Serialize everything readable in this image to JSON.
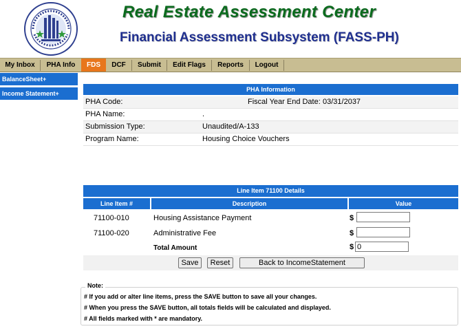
{
  "header": {
    "title": "Real Estate Assessment Center",
    "subtitle": "Financial Assessment Subsystem (FASS-PH)"
  },
  "nav": {
    "items": [
      {
        "label": "My Inbox"
      },
      {
        "label": "PHA Info"
      },
      {
        "label": "FDS",
        "active": true
      },
      {
        "label": "DCF"
      },
      {
        "label": "Submit"
      },
      {
        "label": "Edit Flags"
      },
      {
        "label": "Reports"
      },
      {
        "label": "Logout"
      }
    ]
  },
  "sidebar": {
    "items": [
      {
        "label": "BalanceSheet+"
      },
      {
        "label": "Income Statement+"
      }
    ]
  },
  "pha_info": {
    "title": "PHA Information",
    "code_label": "PHA Code:",
    "fiscal_year_label": "Fiscal Year End Date:",
    "fiscal_year_value": "03/31/2037",
    "name_label": "PHA Name:",
    "name_value": ".",
    "submission_type_label": "Submission Type:",
    "submission_type_value": "Unaudited/A-133",
    "program_name_label": "Program Name:",
    "program_name_value": "Housing Choice Vouchers"
  },
  "line_item": {
    "title": "Line Item 71100 Details",
    "columns": [
      "Line Item #",
      "Description",
      "Value"
    ],
    "rows": [
      {
        "id": "71100-010",
        "description": "Housing Assistance Payment",
        "currency": "$",
        "value": ""
      },
      {
        "id": "71100-020",
        "description": "Administrative Fee",
        "currency": "$",
        "value": ""
      }
    ],
    "total_label": "Total Amount",
    "total_currency": "$",
    "total_value": "0"
  },
  "buttons": {
    "save": "Save",
    "reset": "Reset",
    "back": "Back to IncomeStatement"
  },
  "note": {
    "title": "Note:",
    "lines": [
      "# If you add or alter line items, press the SAVE button to save all your changes.",
      "# When you press the SAVE button, all totals fields will be calculated and displayed.",
      "# All fields marked with * are mandatory."
    ]
  },
  "colors": {
    "title_green": "#0b6b1e",
    "subtitle_blue": "#1f2f8f",
    "nav_bg": "#c8bd92",
    "nav_active": "#e8761c",
    "panel_blue": "#1b6ed0"
  }
}
